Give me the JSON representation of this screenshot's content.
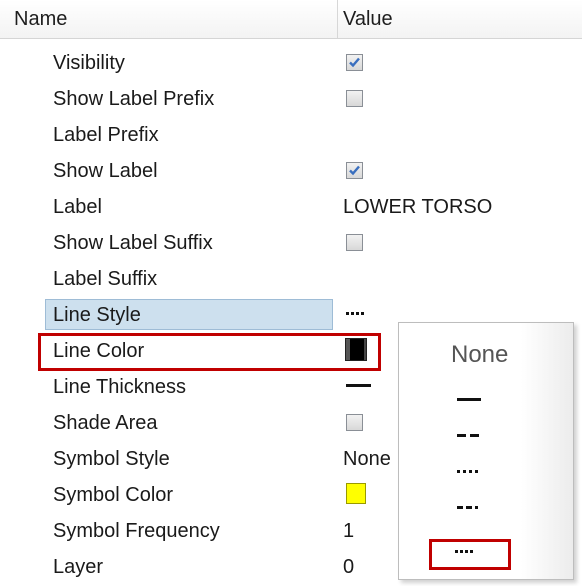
{
  "header": {
    "name": "Name",
    "value": "Value"
  },
  "rows": [
    {
      "name": "Visibility",
      "value_type": "checkbox",
      "checked": true
    },
    {
      "name": "Show Label Prefix",
      "value_type": "checkbox",
      "checked": false
    },
    {
      "name": "Label Prefix",
      "value_type": "text",
      "value": ""
    },
    {
      "name": "Show Label",
      "value_type": "checkbox",
      "checked": true
    },
    {
      "name": "Label",
      "value_type": "text",
      "value": "LOWER TORSO"
    },
    {
      "name": "Show Label Suffix",
      "value_type": "checkbox",
      "checked": false
    },
    {
      "name": "Label Suffix",
      "value_type": "text",
      "value": ""
    },
    {
      "name": "Line Style",
      "value_type": "line-style",
      "value": "dotted",
      "selected": true
    },
    {
      "name": "Line Color",
      "value_type": "color",
      "color": "#000000",
      "highlighted": true
    },
    {
      "name": "Line Thickness",
      "value_type": "line-thickness",
      "value": "solid"
    },
    {
      "name": "Shade Area",
      "value_type": "checkbox",
      "checked": false
    },
    {
      "name": "Symbol Style",
      "value_type": "text",
      "value": "None"
    },
    {
      "name": "Symbol Color",
      "value_type": "color",
      "color": "#ffff00"
    },
    {
      "name": "Symbol Frequency",
      "value_type": "text",
      "value": "1"
    },
    {
      "name": "Layer",
      "value_type": "text",
      "value": "0"
    }
  ],
  "line_style_dropdown": {
    "options": [
      {
        "label": "None",
        "style": "none"
      },
      {
        "label": "",
        "style": "solid"
      },
      {
        "label": "",
        "style": "dashed"
      },
      {
        "label": "",
        "style": "dotted"
      },
      {
        "label": "",
        "style": "dash-dot"
      },
      {
        "label": "",
        "style": "dense-dotted",
        "highlighted": true
      }
    ]
  },
  "colors": {
    "highlight_border": "#c00000",
    "selection_background": "#cde0ee",
    "checkbox_check": "#3a6fbf"
  }
}
